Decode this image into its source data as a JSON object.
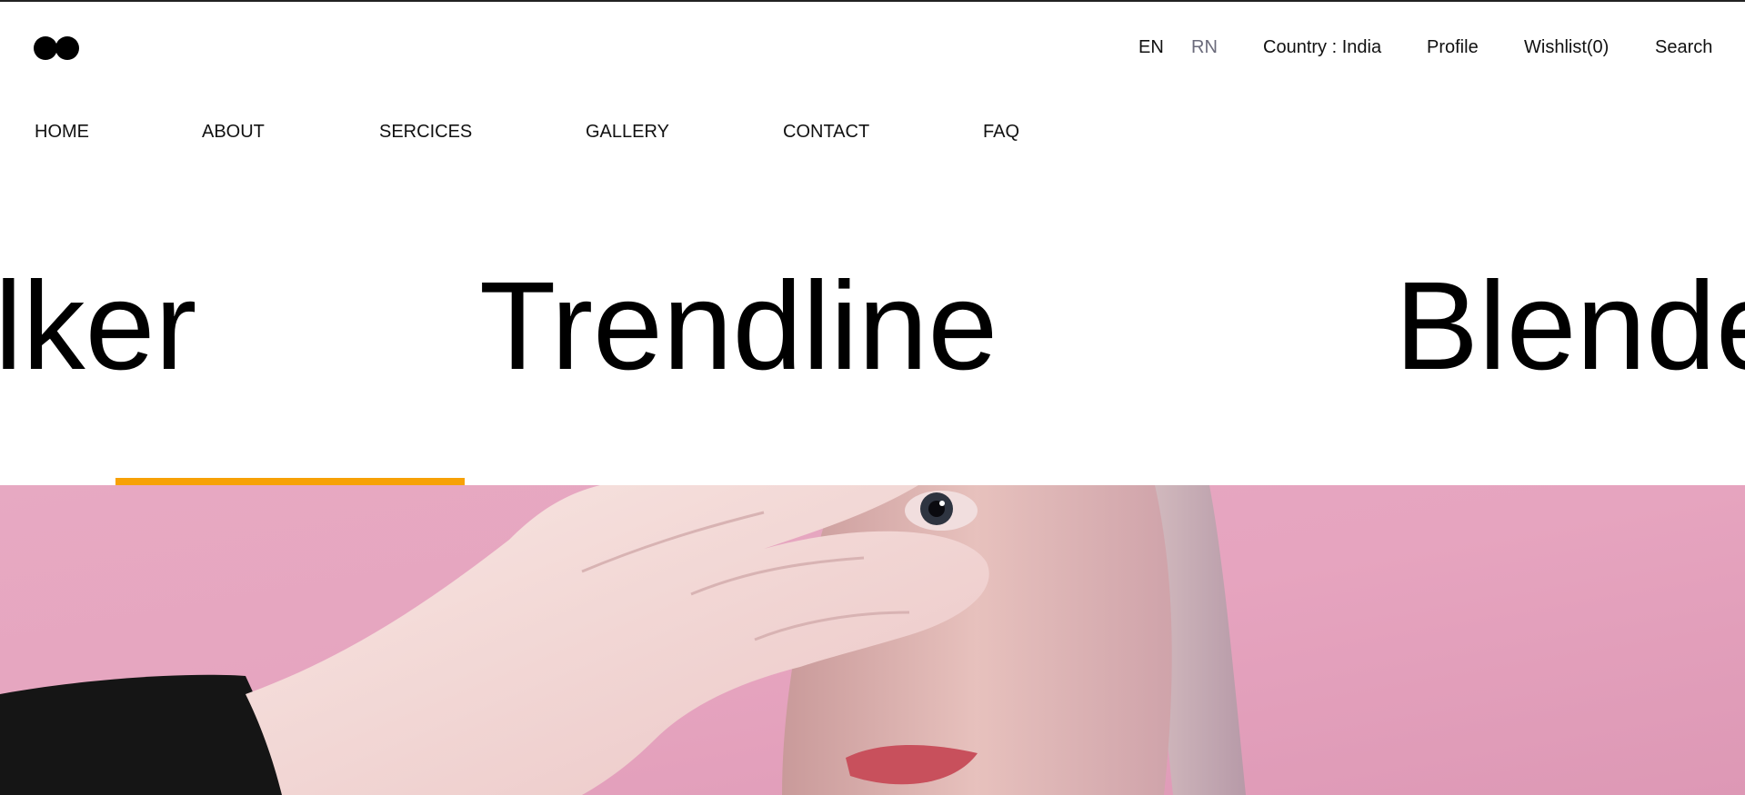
{
  "header": {
    "lang_en": "EN",
    "lang_rn": "RN",
    "country": "Country : India",
    "profile": "Profile",
    "wishlist": "Wishlist(0)",
    "search": "Search"
  },
  "nav": {
    "items": [
      "HOME",
      "ABOUT",
      "SERCICES",
      "GALLERY",
      "CONTACT",
      "FAQ"
    ]
  },
  "marquee": {
    "words": [
      "lker",
      "Trendline",
      "Blende"
    ]
  },
  "colors": {
    "accent": "#f7a106",
    "hero_background": "#e4a6c0",
    "text": "#111111",
    "muted": "#6b6b7b"
  },
  "icons": {
    "logo": "two-black-dots-logo"
  }
}
